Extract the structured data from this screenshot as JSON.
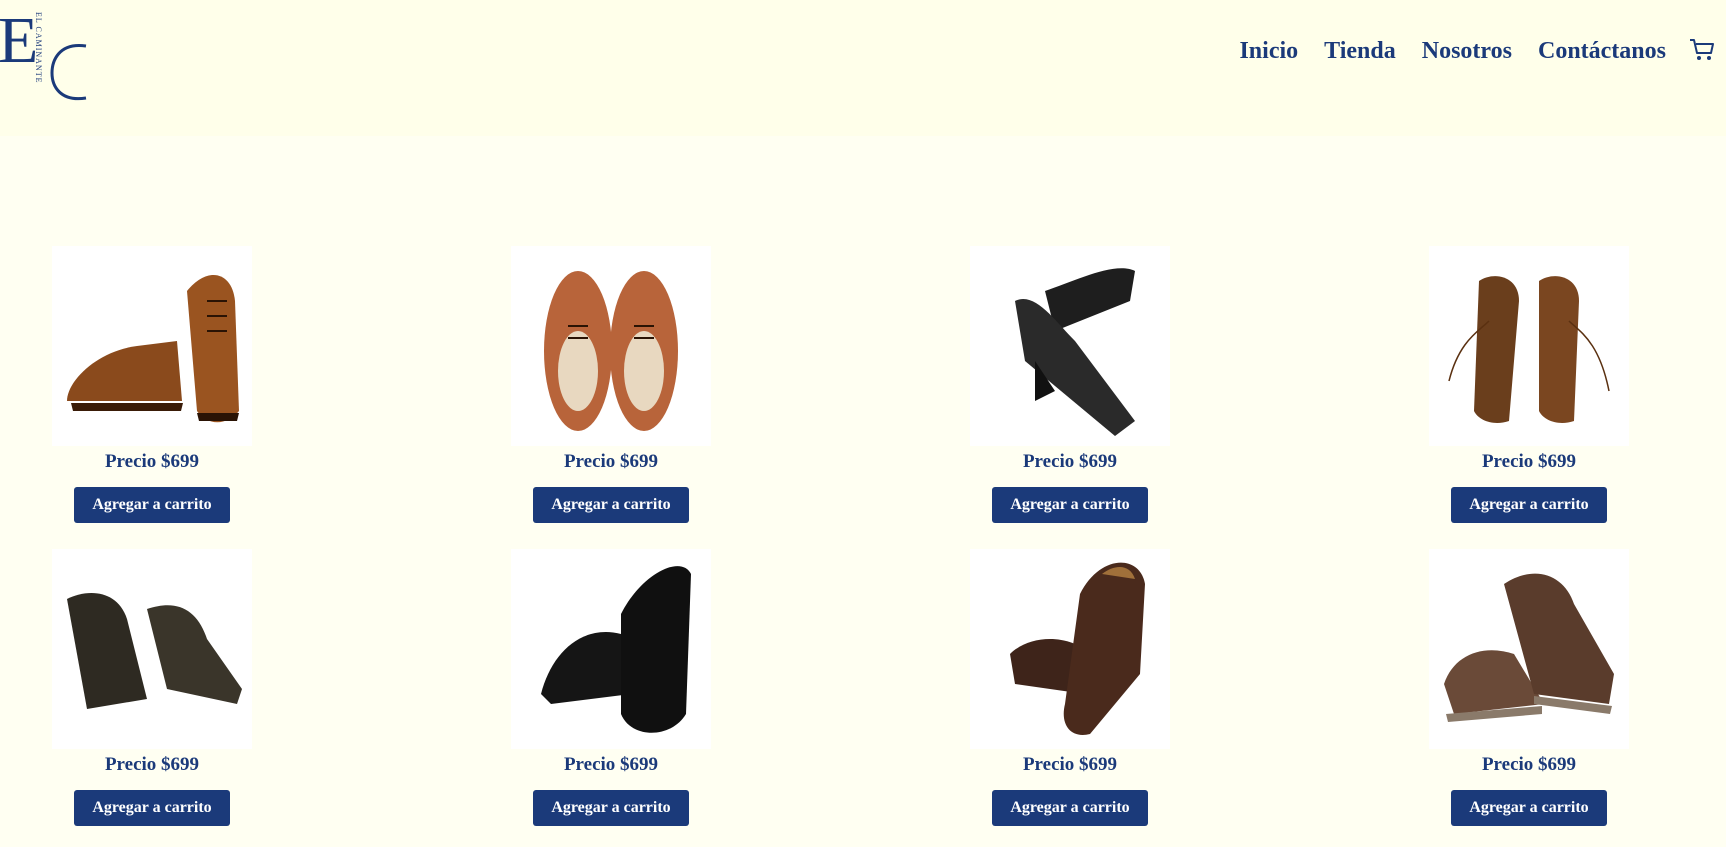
{
  "brand": {
    "letters": "EC",
    "subtitle": "EL CAMINANTE"
  },
  "nav": {
    "items": [
      "Inicio",
      "Tienda",
      "Nosotros",
      "Contáctanos"
    ]
  },
  "colors": {
    "primary": "#1b3a7a",
    "background": "#fffff2",
    "header_background": "#ffffea"
  },
  "products": [
    {
      "image": "brown-wingtip-oxford-pair",
      "price_label": "Precio $699",
      "button_label": "Agregar a carrito"
    },
    {
      "image": "tan-brogue-top-view",
      "price_label": "Precio $699",
      "button_label": "Agregar a carrito"
    },
    {
      "image": "black-pointed-derby",
      "price_label": "Precio $699",
      "button_label": "Agregar a carrito"
    },
    {
      "image": "bronze-oxford-pair",
      "price_label": "Precio $699",
      "button_label": "Agregar a carrito"
    },
    {
      "image": "dark-cap-toe-oxford",
      "price_label": "Precio $699",
      "button_label": "Agregar a carrito"
    },
    {
      "image": "black-brogue-derby",
      "price_label": "Precio $699",
      "button_label": "Agregar a carrito"
    },
    {
      "image": "brown-slip-on-loafer",
      "price_label": "Precio $699",
      "button_label": "Agregar a carrito"
    },
    {
      "image": "brown-casual-derby",
      "price_label": "Precio $699",
      "button_label": "Agregar a carrito"
    }
  ]
}
